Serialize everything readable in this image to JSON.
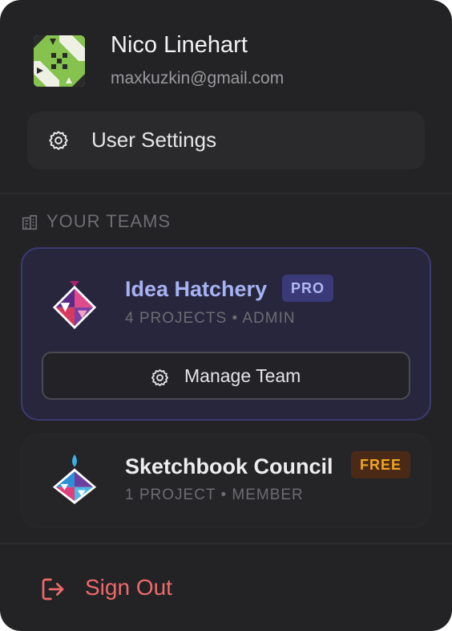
{
  "user": {
    "name": "Nico Linehart",
    "email": "maxkuzkin@gmail.com",
    "avatar_icon": "geometric-avatar-icon"
  },
  "menu": {
    "settings_label": "User Settings",
    "settings_icon": "gear-icon"
  },
  "teams_section": {
    "heading": "YOUR TEAMS",
    "heading_icon": "building-icon",
    "teams": [
      {
        "name": "Idea Hatchery",
        "badge": "PRO",
        "meta": "4 PROJECTS • ADMIN",
        "manage_label": "Manage Team",
        "selected": true,
        "colors": {
          "name": "#a7b2f2",
          "badge_bg": "#3a3a78",
          "badge_text": "#b2b8f4"
        }
      },
      {
        "name": "Sketchbook Council",
        "badge": "FREE",
        "meta": "1 PROJECT • MEMBER",
        "selected": false,
        "colors": {
          "name": "#ededef",
          "badge_bg": "#4a2a16",
          "badge_text": "#f0a622"
        }
      }
    ]
  },
  "signout": {
    "label": "Sign Out",
    "icon": "logout-icon",
    "color": "#f06a6a"
  }
}
